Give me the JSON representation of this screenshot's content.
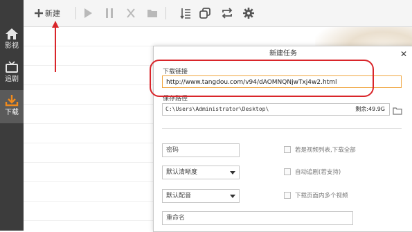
{
  "rail": {
    "items": [
      {
        "label": "影视",
        "icon": "home-icon"
      },
      {
        "label": "追剧",
        "icon": "tv-icon"
      },
      {
        "label": "下载",
        "icon": "download-icon"
      }
    ],
    "active_index": 2
  },
  "toolbar": {
    "new_label": "新建",
    "icons": [
      "play-icon",
      "pause-icon",
      "delete-icon",
      "folder-icon",
      "list-sort-icon",
      "copy-icon",
      "repeat-icon",
      "settings-icon"
    ]
  },
  "dialog": {
    "title": "新建任务",
    "close_glyph": "✕",
    "url_label": "下载链接",
    "url_value": "http://www.tangdou.com/v94/dAOMNQNjwTxj4w2.html",
    "save_label": "保存路径",
    "save_path": "C:\\Users\\Administrator\\Desktop\\",
    "free_space": "剩余:49.9G",
    "password_placeholder": "密码",
    "quality_select": "默认清晰度",
    "audio_select": "默认配音",
    "rename_placeholder": "重命名",
    "options": [
      {
        "label": "若是视频列表,下载全部",
        "checked": false
      },
      {
        "label": "自动追剧(若支持)",
        "checked": false
      },
      {
        "label": "下载页面内多个视频",
        "checked": false
      }
    ]
  },
  "colors": {
    "rail_bg": "#3c3c3c",
    "toolbar_bg": "#f5f5f5",
    "input_focus": "#f0a43c",
    "annotation_red": "#d9252a",
    "download_accent": "#f08a1c"
  }
}
